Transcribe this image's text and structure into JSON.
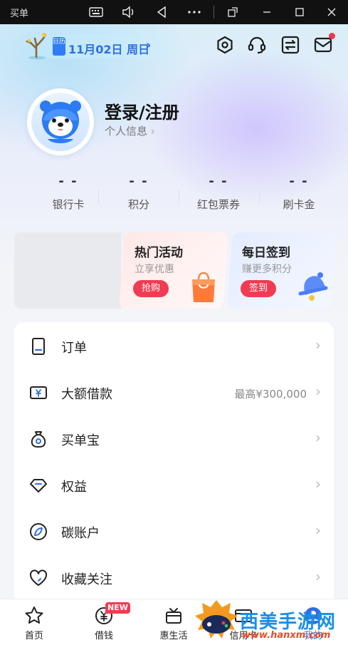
{
  "system_bar": {
    "app_title": "买单",
    "icons": [
      "keyboard-icon",
      "volume-icon",
      "back-triangle-icon",
      "more-icon",
      "rotate-icon",
      "minimize-icon",
      "maximize-icon",
      "close-icon"
    ]
  },
  "header": {
    "calendar_tag": "日历",
    "date": "11月02日 周日",
    "icons": [
      "settings-hex-icon",
      "customer-service-icon",
      "transfer-icon",
      "message-icon"
    ]
  },
  "profile": {
    "title": "登录/注册",
    "subtitle": "个人信息"
  },
  "stats": [
    {
      "value": "- -",
      "label": "银行卡"
    },
    {
      "value": "- -",
      "label": "积分"
    },
    {
      "value": "- -",
      "label": "红包票券"
    },
    {
      "value": "- -",
      "label": "刷卡金"
    }
  ],
  "promos": [
    {
      "title": "热门活动",
      "subtitle": "立享优惠",
      "button": "抢购"
    },
    {
      "title": "每日签到",
      "subtitle": "赚更多积分",
      "button": "签到"
    }
  ],
  "menu": [
    {
      "label": "订单",
      "extra": ""
    },
    {
      "label": "大额借款",
      "extra": "最高¥300,000"
    },
    {
      "label": "买单宝",
      "extra": ""
    },
    {
      "label": "权益",
      "extra": ""
    },
    {
      "label": "碳账户",
      "extra": ""
    },
    {
      "label": "收藏关注",
      "extra": ""
    }
  ],
  "bottom_nav": [
    {
      "label": "首页"
    },
    {
      "label": "借钱",
      "badge": "NEW"
    },
    {
      "label": "惠生活"
    },
    {
      "label": "信用卡"
    },
    {
      "label": "我的"
    }
  ],
  "watermark": {
    "text": "西美手游网",
    "url": "www.hanxm.com"
  },
  "colors": {
    "accent_blue": "#2f6fe0",
    "accent_red": "#f23b52"
  }
}
